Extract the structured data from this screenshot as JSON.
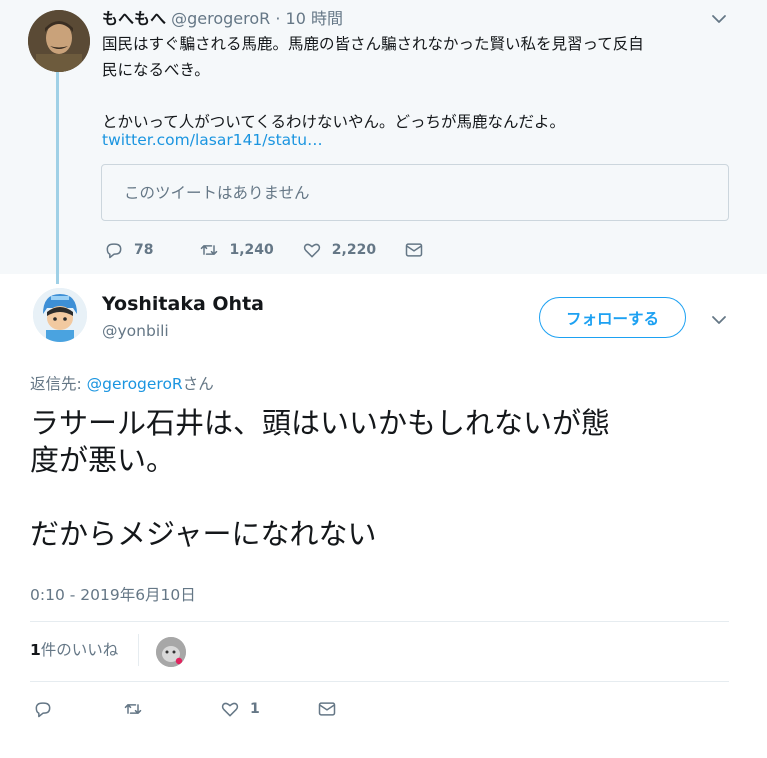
{
  "parent_tweet": {
    "display_name": "もへもへ",
    "handle": "@gerogeroR",
    "separator": "·",
    "time": "10 時間",
    "text": "国民はすぐ騙される馬鹿。馬鹿の皆さん騙されなかった賢い私を見習って反自\n民になるべき。\n\nとかいって人がついてくるわけないやん。どっちが馬鹿なんだよ。",
    "link": "twitter.com/lasar141/statu…",
    "quote_unavailable": "このツイートはありません",
    "counts": {
      "replies": "78",
      "retweets": "1,240",
      "likes": "2,220"
    }
  },
  "main_tweet": {
    "display_name": "Yoshitaka Ohta",
    "handle": "@yonbili",
    "follow_label": "フォローする",
    "reply_prefix": "返信先: ",
    "reply_mention": "@gerogeroR",
    "reply_suffix": "さん",
    "text": "ラサール石井は、頭はいいかもしれないが態\n度が悪い。\n\nだからメジャーになれない",
    "timestamp": "0:10 - 2019年6月10日",
    "likes_count": "1",
    "likes_label": "件のいいね",
    "action_like_count": "1"
  },
  "icons": [
    "chevron-down-icon",
    "reply-icon",
    "retweet-icon",
    "heart-icon",
    "mail-icon"
  ],
  "colors": {
    "link": "#1b95e0",
    "accent": "#1da1f2",
    "muted": "#657786",
    "parent_bg": "#f5f8fa",
    "thread_line": "#9fd0e6"
  }
}
